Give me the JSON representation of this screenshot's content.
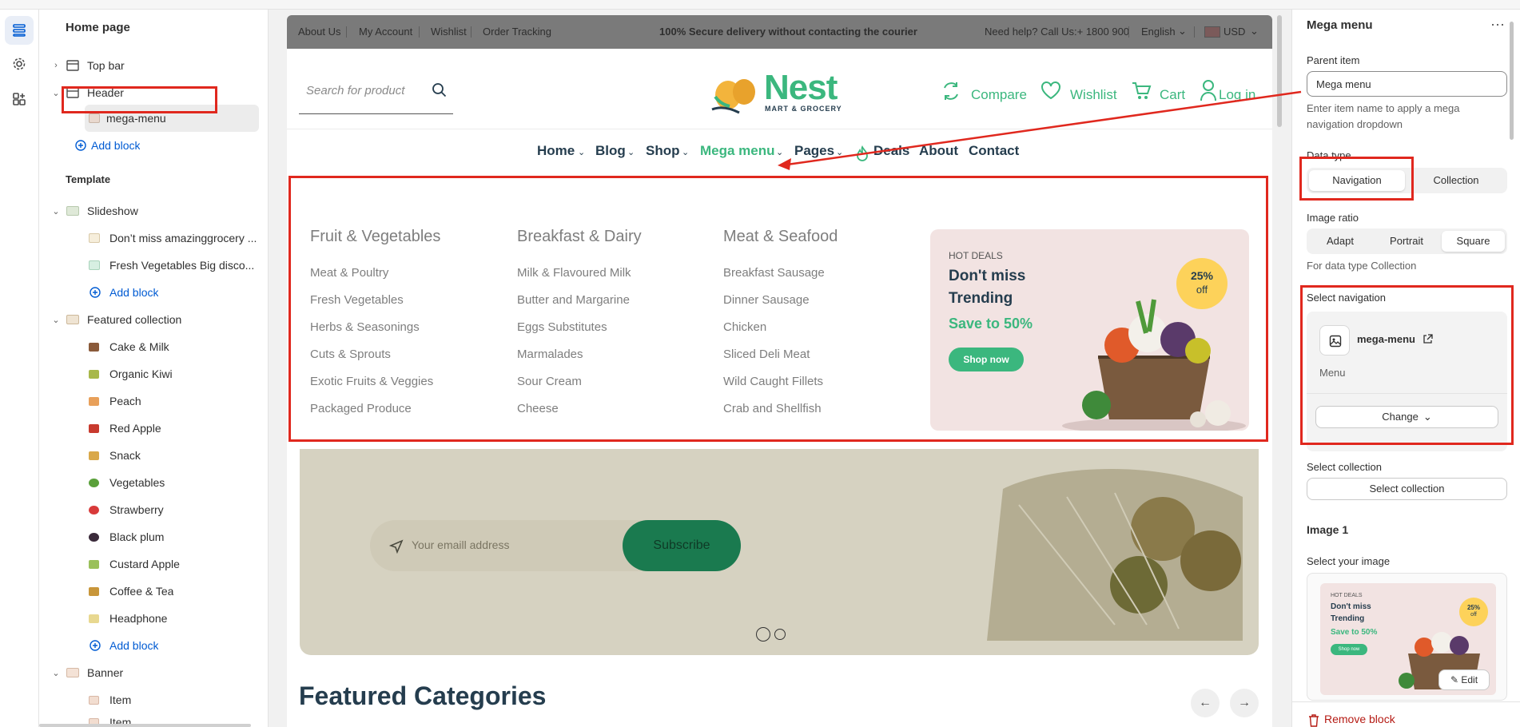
{
  "sidebar": {
    "title": "Home page",
    "rows": [
      {
        "label": "Top bar"
      },
      {
        "label": "Header"
      },
      {
        "label": "mega-menu"
      },
      {
        "label": "Add block"
      },
      {
        "label": "Slideshow"
      },
      {
        "label": "Don’t miss amazinggrocery ..."
      },
      {
        "label": "Fresh Vegetables Big disco..."
      },
      {
        "label": "Add block"
      },
      {
        "label": "Featured collection"
      },
      {
        "label": "Cake & Milk"
      },
      {
        "label": "Organic Kiwi"
      },
      {
        "label": "Peach"
      },
      {
        "label": "Red Apple"
      },
      {
        "label": "Snack"
      },
      {
        "label": "Vegetables"
      },
      {
        "label": "Strawberry"
      },
      {
        "label": "Black plum"
      },
      {
        "label": "Custard Apple"
      },
      {
        "label": "Coffee & Tea"
      },
      {
        "label": "Headphone"
      },
      {
        "label": "Add block"
      },
      {
        "label": "Banner"
      },
      {
        "label": "Item"
      },
      {
        "label": "Item"
      }
    ],
    "template_heading": "Template"
  },
  "store": {
    "topbar": {
      "links": [
        "About Us",
        "My Account",
        "Wishlist",
        "Order Tracking"
      ],
      "center": "100% Secure delivery without contacting the courier",
      "help": "Need help? Call Us:+ 1800 900",
      "language": "English",
      "currency": "USD"
    },
    "search_placeholder": "Search for product",
    "logo": {
      "name": "Nest",
      "tagline": "MART & GROCERY"
    },
    "header_links": {
      "compare": "Compare",
      "wishlist": "Wishlist",
      "cart": "Cart",
      "login": "Log in"
    },
    "nav": [
      "Home",
      "Blog",
      "Shop",
      "Mega menu",
      "Pages",
      "Deals",
      "About",
      "Contact"
    ],
    "mega": {
      "columns": [
        {
          "heading": "Fruit & Vegetables",
          "items": [
            "Meat & Poultry",
            "Fresh Vegetables",
            "Herbs & Seasonings",
            "Cuts & Sprouts",
            "Exotic Fruits & Veggies",
            "Packaged Produce"
          ]
        },
        {
          "heading": "Breakfast & Dairy",
          "items": [
            "Milk & Flavoured Milk",
            "Butter and Margarine",
            "Eggs Substitutes",
            "Marmalades",
            "Sour Cream",
            "Cheese"
          ]
        },
        {
          "heading": "Meat & Seafood",
          "items": [
            "Breakfast Sausage",
            "Dinner Sausage",
            "Chicken",
            "Sliced Deli Meat",
            "Wild Caught Fillets",
            "Crab and Shellfish"
          ]
        }
      ],
      "promo": {
        "eyebrow": "HOT DEALS",
        "line1": "Don't miss",
        "line2": "Trending",
        "save": "Save to 50%",
        "button": "Shop now",
        "badge_pct": "25%",
        "badge_off": "off"
      }
    },
    "newsletter": {
      "placeholder": "Your emaill address",
      "button": "Subscribe"
    },
    "featured_title": "Featured Categories"
  },
  "panel": {
    "title": "Mega menu",
    "parent_item_label": "Parent item",
    "parent_item_value": "Mega menu",
    "parent_item_help": "Enter item name to apply a mega navigation dropdown",
    "data_type_label": "Data type",
    "data_type_options": [
      "Navigation",
      "Collection"
    ],
    "image_ratio_label": "Image ratio",
    "image_ratio_options": [
      "Adapt",
      "Portrait",
      "Square"
    ],
    "image_ratio_help": "For data type Collection",
    "select_navigation_label": "Select navigation",
    "navigation_name": "mega-menu",
    "navigation_type": "Menu",
    "change_button": "Change",
    "select_collection_label": "Select collection",
    "select_collection_button": "Select collection",
    "image1_heading": "Image 1",
    "select_image_label": "Select your image",
    "edit_button": "Edit",
    "remove_block": "Remove block"
  },
  "colors": {
    "accent_green": "#3bb77e",
    "annotation_red": "#e0281e",
    "link_blue": "#005bd3",
    "danger": "#b51b14"
  }
}
